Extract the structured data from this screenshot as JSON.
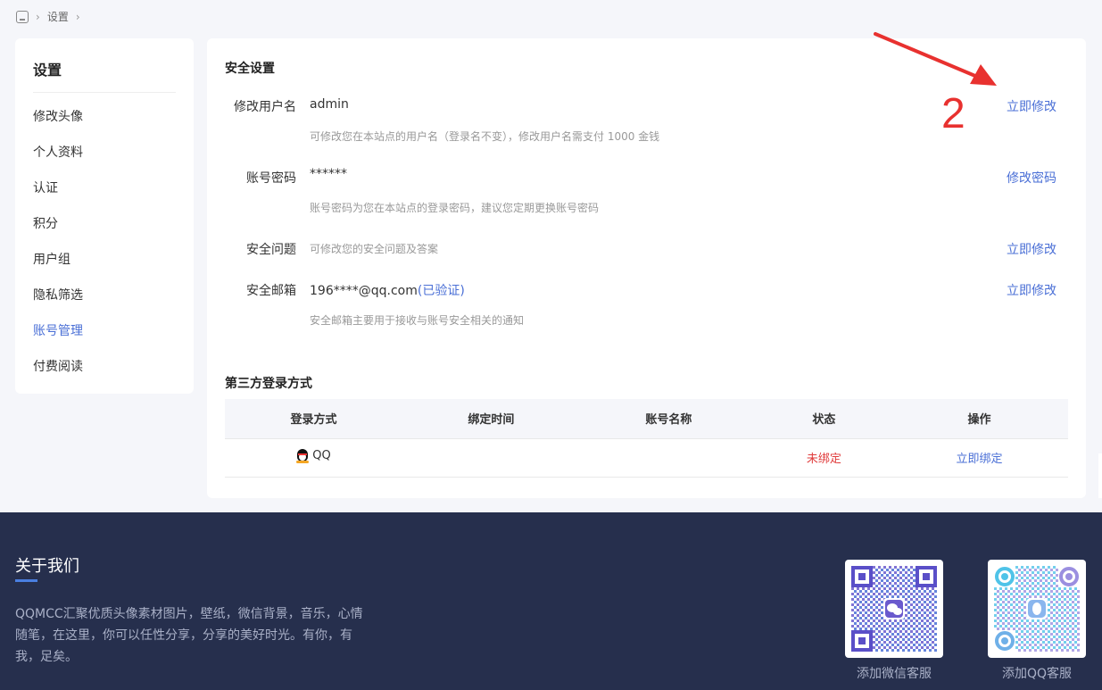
{
  "breadcrumb": {
    "current": "设置",
    "sep": "›"
  },
  "sidebar": {
    "title": "设置",
    "items": [
      {
        "label": "修改头像"
      },
      {
        "label": "个人资料"
      },
      {
        "label": "认证"
      },
      {
        "label": "积分"
      },
      {
        "label": "用户组"
      },
      {
        "label": "隐私筛选"
      },
      {
        "label": "账号管理",
        "active": true
      },
      {
        "label": "付费阅读"
      }
    ]
  },
  "security": {
    "title": "安全设置",
    "username": {
      "label": "修改用户名",
      "value": "admin",
      "desc": "可修改您在本站点的用户名（登录名不变），修改用户名需支付 1000 金钱",
      "action": "立即修改"
    },
    "password": {
      "label": "账号密码",
      "value": "******",
      "desc": "账号密码为您在本站点的登录密码，建议您定期更换账号密码",
      "action": "修改密码"
    },
    "question": {
      "label": "安全问题",
      "desc": "可修改您的安全问题及答案",
      "action": "立即修改"
    },
    "email": {
      "label": "安全邮箱",
      "value": "196****@qq.com",
      "verified": "(已验证)",
      "desc": "安全邮箱主要用于接收与账号安全相关的通知",
      "action": "立即修改"
    }
  },
  "third_party": {
    "title": "第三方登录方式",
    "headers": [
      "登录方式",
      "绑定时间",
      "账号名称",
      "状态",
      "操作"
    ],
    "rows": [
      {
        "method": "QQ",
        "bind_time": "",
        "account": "",
        "status": "未绑定",
        "action": "立即绑定"
      }
    ]
  },
  "annotation": {
    "number": "2",
    "color": "#e8312f"
  },
  "footer": {
    "about_title": "关于我们",
    "about_text": "QQMCC汇聚优质头像素材图片，壁纸，微信背景，音乐，心情随笔，在这里，你可以任性分享，分享的美好时光。有你，有我，足矣。",
    "qr_wechat_caption": "添加微信客服",
    "qr_qq_caption": "添加QQ客服"
  },
  "colors": {
    "accent": "#4a6fd6",
    "danger": "#e03b3b",
    "footer_bg": "#262f4d"
  }
}
